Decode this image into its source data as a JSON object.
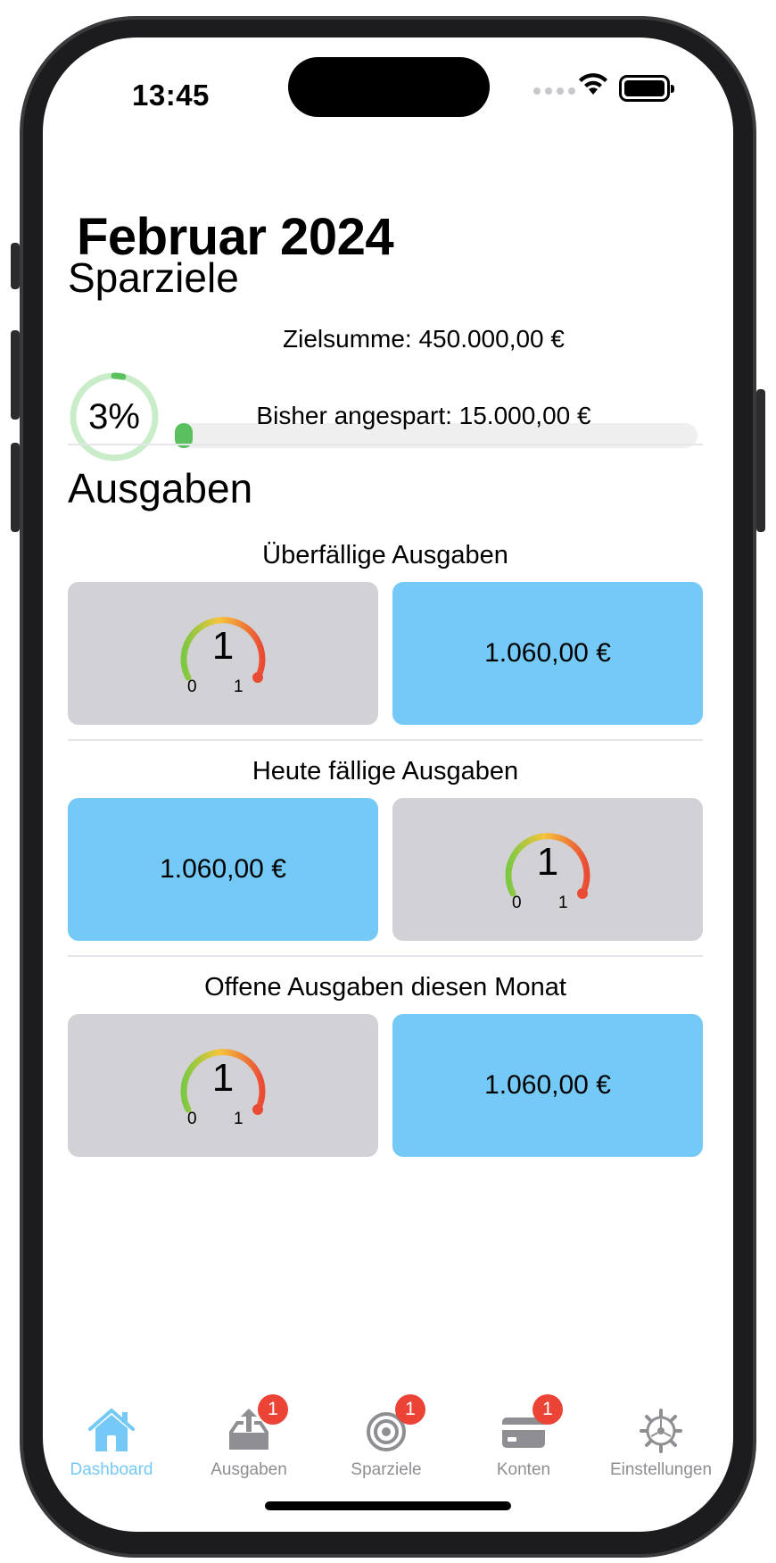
{
  "status_bar": {
    "time": "13:45"
  },
  "header": {
    "title": "Februar 2024"
  },
  "savings": {
    "heading": "Sparziele",
    "percent_label": "3%",
    "progress_fraction": 0.03,
    "goal_label": "Zielsumme: 450.000,00 €",
    "saved_label": "Bisher angespart: 15.000,00 €"
  },
  "expenses": {
    "heading": "Ausgaben",
    "groups": [
      {
        "title": "Überfällige Ausgaben",
        "gauge": {
          "value": "1",
          "min": "0",
          "max": "1"
        },
        "amount": "1.060,00 €"
      },
      {
        "title": "Heute fällige Ausgaben",
        "gauge": {
          "value": "1",
          "min": "0",
          "max": "1"
        },
        "amount": "1.060,00 €"
      },
      {
        "title": "Offene Ausgaben diesen Monat",
        "gauge": {
          "value": "1",
          "min": "0",
          "max": "1"
        },
        "amount": "1.060,00 €"
      }
    ]
  },
  "tabbar": {
    "items": [
      {
        "label": "Dashboard",
        "icon": "house-icon",
        "badge": ""
      },
      {
        "label": "Ausgaben",
        "icon": "tray-upload-icon",
        "badge": "1"
      },
      {
        "label": "Sparziele",
        "icon": "target-icon",
        "badge": "1"
      },
      {
        "label": "Konten",
        "icon": "credit-card-icon",
        "badge": "1"
      },
      {
        "label": "Einstellungen",
        "icon": "gear-icon",
        "badge": ""
      }
    ],
    "active_color": "#74c9f6",
    "inactive_color": "#8e8e93"
  },
  "colors": {
    "progress_green": "#5ac05d",
    "tile_blue": "#74c9f6",
    "tile_gray": "#d1d1d6",
    "badge_red": "#eb4336"
  }
}
